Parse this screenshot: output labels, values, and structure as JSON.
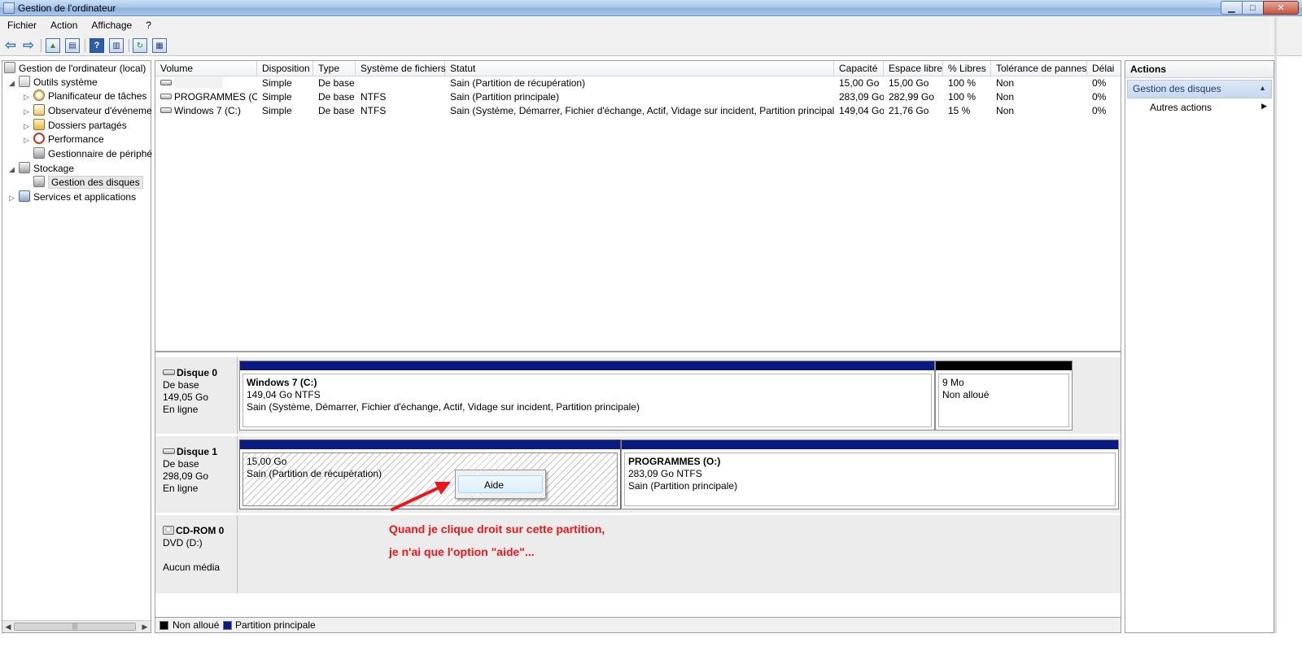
{
  "window": {
    "title": "Gestion de l'ordinateur",
    "controls": {
      "minimize": "▁",
      "maximize": "□",
      "close": "✕"
    }
  },
  "menu": [
    "Fichier",
    "Action",
    "Affichage",
    "?"
  ],
  "toolbar": [
    {
      "name": "back-icon",
      "glyph": "⇦"
    },
    {
      "name": "forward-icon",
      "glyph": "⇨"
    },
    {
      "name": "up-folder-icon",
      "glyph": "▲"
    },
    {
      "name": "show-hide-tree-icon",
      "glyph": "▤"
    },
    {
      "name": "help-icon",
      "glyph": "?"
    },
    {
      "name": "show-hide-action-pane-icon",
      "glyph": "▥"
    },
    {
      "name": "refresh-icon",
      "glyph": "↻"
    },
    {
      "name": "properties-icon",
      "glyph": "▦"
    }
  ],
  "tree": {
    "root": "Gestion de l'ordinateur (local)",
    "nodes": [
      {
        "label": "Outils système"
      },
      {
        "label": "Planificateur de tâches"
      },
      {
        "label": "Observateur d'événeme"
      },
      {
        "label": "Dossiers partagés"
      },
      {
        "label": "Performance"
      },
      {
        "label": "Gestionnaire de périphé"
      },
      {
        "label": "Stockage"
      },
      {
        "label": "Gestion des disques"
      },
      {
        "label": "Services et applications"
      }
    ],
    "scroll_thumb": "|||",
    "scroll_left": "◀",
    "scroll_right": "▶"
  },
  "volumes": {
    "columns": [
      "Volume",
      "Disposition",
      "Type",
      "Système de fichiers",
      "Statut",
      "Capacité",
      "Espace libre",
      "% Libres",
      "Tolérance de pannes",
      "Délai"
    ],
    "rows": [
      [
        "",
        "Simple",
        "De base",
        "",
        "Sain (Partition de récupération)",
        "15,00 Go",
        "15,00 Go",
        "100 %",
        "Non",
        "0%"
      ],
      [
        "PROGRAMMES (O:)",
        "Simple",
        "De base",
        "NTFS",
        "Sain (Partition principale)",
        "283,09 Go",
        "282,99 Go",
        "100 %",
        "Non",
        "0%"
      ],
      [
        "Windows 7 (C:)",
        "Simple",
        "De base",
        "NTFS",
        "Sain (Système, Démarrer, Fichier d'échange, Actif, Vidage sur incident, Partition principale)",
        "149,04 Go",
        "21,76 Go",
        "15 %",
        "Non",
        "0%"
      ]
    ]
  },
  "disks": [
    {
      "name": "Disque 0",
      "type": "De base",
      "size": "149,05 Go",
      "status": "En ligne",
      "partitions": [
        {
          "name": "Windows 7  (C:)",
          "size": "149,04 Go NTFS",
          "status": "Sain (Système, Démarrer, Fichier d'échange, Actif, Vidage sur incident, Partition principale)"
        },
        {
          "name": "",
          "size": "9 Mo",
          "status": "Non alloué"
        }
      ]
    },
    {
      "name": "Disque 1",
      "type": "De base",
      "size": "298,09 Go",
      "status": "En ligne",
      "partitions": [
        {
          "name": "",
          "size": "15,00 Go",
          "status": "Sain (Partition de récupération)"
        },
        {
          "name": "PROGRAMMES  (O:)",
          "size": "283,09 Go NTFS",
          "status": "Sain (Partition principale)"
        }
      ]
    },
    {
      "name": "CD-ROM 0",
      "type": "DVD (D:)",
      "size": "",
      "status": "Aucun média"
    }
  ],
  "context_menu": {
    "items": [
      "Aide"
    ]
  },
  "annotation": {
    "line1": "Quand je clique droit sur cette partition,",
    "line2": "je n'ai que l'option \"aide\"...",
    "color": "#e8171c"
  },
  "legend": [
    {
      "label": "Non alloué",
      "color": "#000000"
    },
    {
      "label": "Partition principale",
      "color": "#0a1a80"
    }
  ],
  "actions": {
    "title": "Actions",
    "section": "Gestion des disques",
    "section_caret": "▲",
    "more": "Autres actions",
    "more_caret": "▶"
  }
}
